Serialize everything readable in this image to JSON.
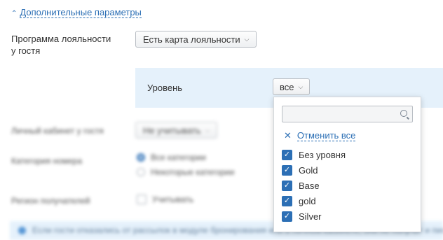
{
  "toggle": {
    "label": "Дополнительные параметры"
  },
  "loyalty": {
    "label": "Программа лояльности у гостя",
    "value": "Есть карта лояльности"
  },
  "level": {
    "label": "Уровень",
    "value": "все"
  },
  "cabinet": {
    "label": "Личный кабинет у гостя",
    "value": "Не учитывать"
  },
  "room_category": {
    "label": "Категория номера",
    "options": [
      {
        "label": "Все категории",
        "selected": true
      },
      {
        "label": "Некоторые категории",
        "selected": false
      }
    ]
  },
  "region": {
    "label": "Регион получателей",
    "checkbox_label": "Учитывать"
  },
  "info": {
    "text": "Если гости отказались от рассылок в модуле бронирования или в личном кабинете, они не получат и письма"
  },
  "dropdown": {
    "search_placeholder": "",
    "cancel_all": "Отменить все",
    "options": [
      {
        "label": "Без уровня",
        "checked": true
      },
      {
        "label": "Gold",
        "checked": true
      },
      {
        "label": "Base",
        "checked": true
      },
      {
        "label": "gold",
        "checked": true
      },
      {
        "label": "Silver",
        "checked": true
      }
    ]
  },
  "colors": {
    "accent": "#2c6fb5",
    "panel_bg": "#e5f1fb"
  }
}
